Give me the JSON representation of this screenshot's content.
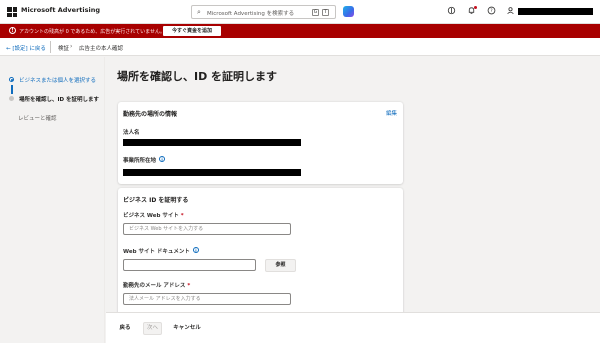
{
  "header": {
    "brand": "Microsoft Advertising",
    "search_placeholder": "Microsoft Advertising を検索する",
    "search_keys": [
      "G",
      "T"
    ],
    "icons": [
      "copilot-icon",
      "lightbulb-icon",
      "notifications-icon",
      "help-icon",
      "account-icon"
    ]
  },
  "banner": {
    "message": "アカウントの残高が 0 であるため、広告が実行されていません。",
    "button": "今すぐ資金を追加",
    "color": "#a80000"
  },
  "breadcrumb": {
    "back": "[設定] に戻る",
    "crumb1": "検証",
    "crumb2": "広告主の本人確認"
  },
  "steps": [
    {
      "label": "ビジネスまたは個人を選択する",
      "state": "completed"
    },
    {
      "label": "場所を確認し、ID を証明します",
      "state": "current"
    },
    {
      "label": "レビューと確認",
      "state": "upcoming"
    }
  ],
  "page": {
    "title": "場所を確認し、ID を証明します"
  },
  "location_card": {
    "title": "勤務先の場所の情報",
    "edit": "編集",
    "legal_name_label": "法人名",
    "address_label": "事業所所在地"
  },
  "identity_card": {
    "title": "ビジネス ID を証明する",
    "website_label": "ビジネス Web サイト",
    "website_placeholder": "ビジネス Web サイトを入力する",
    "document_label": "Web サイト ドキュメント",
    "browse": "参照",
    "email_label": "勤務先のメール アドレス",
    "email_placeholder": "法人メール アドレスを入力する",
    "required_mark": "*"
  },
  "footer": {
    "back": "戻る",
    "next": "次へ",
    "cancel": "キャンセル"
  },
  "colors": {
    "accent": "#0f6cbd",
    "banner": "#a80000"
  }
}
